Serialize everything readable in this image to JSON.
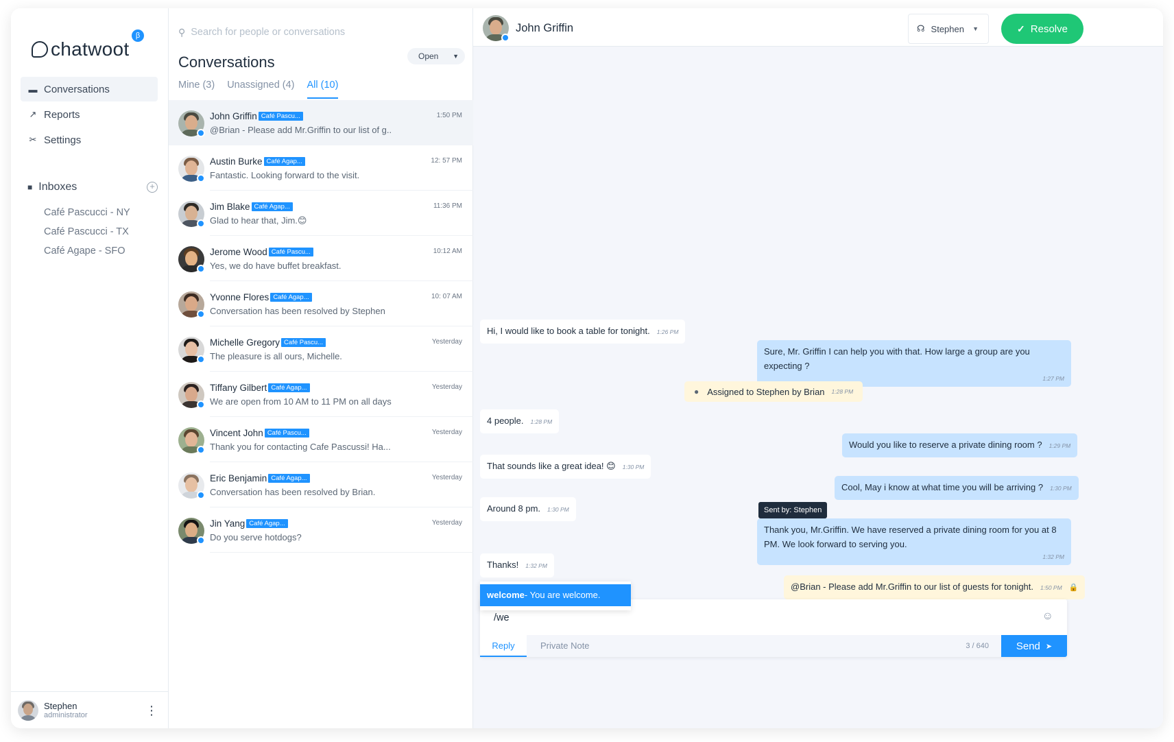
{
  "brand": {
    "name": "chatwoot",
    "beta": "β"
  },
  "sidebar": {
    "nav": [
      {
        "label": "Conversations",
        "icon": "chat-icon",
        "glyph": "▬"
      },
      {
        "label": "Reports",
        "icon": "trend-icon",
        "glyph": "↗"
      },
      {
        "label": "Settings",
        "icon": "tools-icon",
        "glyph": "✂"
      }
    ],
    "inboxes_label": "Inboxes",
    "inboxes": [
      "Café Pascucci - NY",
      "Café Pascucci - TX",
      "Café Agape - SFO"
    ],
    "profile": {
      "name": "Stephen",
      "role": "administrator"
    }
  },
  "list": {
    "search_placeholder": "Search for people or conversations",
    "title": "Conversations",
    "status": "Open",
    "tabs": [
      "Mine (3)",
      "Unassigned (4)",
      "All (10)"
    ],
    "conversations": [
      {
        "name": "John Griffin",
        "inbox": "Café Pascu...",
        "msg": "@Brian - Please add Mr.Griffin to our list of g..",
        "time": "1:50 PM"
      },
      {
        "name": "Austin Burke",
        "inbox": "Café Agap...",
        "msg": "Fantastic. Looking forward to the visit.",
        "time": "12: 57 PM"
      },
      {
        "name": "Jim Blake",
        "inbox": "Café Agap...",
        "msg": "Glad to hear that, Jim.😊",
        "time": "11:36 PM"
      },
      {
        "name": "Jerome Wood",
        "inbox": "Café Pascu...",
        "msg": "Yes, we do have buffet breakfast.",
        "time": "10:12 AM"
      },
      {
        "name": "Yvonne Flores",
        "inbox": "Café Agap...",
        "msg": "Conversation has been resolved by Stephen",
        "time": "10: 07 AM"
      },
      {
        "name": "Michelle Gregory",
        "inbox": "Café Pascu...",
        "msg": "The pleasure is all ours, Michelle.",
        "time": "Yesterday"
      },
      {
        "name": "Tiffany Gilbert",
        "inbox": "Café Agap...",
        "msg": "We are open from 10 AM to 11 PM on all days",
        "time": "Yesterday"
      },
      {
        "name": "Vincent John",
        "inbox": "Café Pascu...",
        "msg": "Thank you for contacting Cafe Pascussi! Ha...",
        "time": "Yesterday"
      },
      {
        "name": "Eric Benjamin",
        "inbox": "Café Agap...",
        "msg": "Conversation has been resolved by Brian.",
        "time": "Yesterday"
      },
      {
        "name": "Jin Yang",
        "inbox": "Café Agap...",
        "msg": "Do you serve hotdogs?",
        "time": "Yesterday"
      }
    ]
  },
  "chat": {
    "contact_name": "John Griffin",
    "agent": "Stephen",
    "resolve_label": "Resolve",
    "messages": [
      {
        "text": "Hi, I would like to book a table for tonight.",
        "time": "1:26 PM"
      },
      {
        "text": "Sure, Mr. Griffin I can help you with that. How large a group are you expecting ?",
        "time": "1:27 PM"
      },
      {
        "text": "Assigned to Stephen by Brian",
        "time": "1:28 PM"
      },
      {
        "text": "4 people.",
        "time": "1:28 PM"
      },
      {
        "text": "Would you like to reserve a private dining room ?",
        "time": "1:29 PM"
      },
      {
        "text": "That sounds like a great idea! 😊",
        "time": "1:30 PM"
      },
      {
        "text": "Cool, May i know at what time you will be arriving ?",
        "time": "1:30 PM"
      },
      {
        "text": "Around 8 pm.",
        "time": "1:30 PM"
      },
      {
        "text": "Thank you, Mr.Griffin. We have reserved a private dining room for you at 8 PM. We look forward to serving you.",
        "time": "1:32 PM"
      },
      {
        "text": "Thanks!",
        "time": "1:32 PM"
      },
      {
        "text": "@Brian - Please add Mr.Griffin to our list of guests for tonight.",
        "time": "1:50 PM"
      }
    ],
    "tooltip": "Sent by: Stephen",
    "canned": {
      "key": "welcome",
      "text": "- You are welcome."
    },
    "composer": {
      "value": "/we",
      "reply_tab": "Reply",
      "note_tab": "Private Note",
      "count": "3 / 640",
      "send_label": "Send"
    }
  },
  "colors": {
    "accent": "#1f93ff",
    "success": "#1fc776",
    "outgoing": "#c7e3ff",
    "note": "#fff6dc"
  }
}
